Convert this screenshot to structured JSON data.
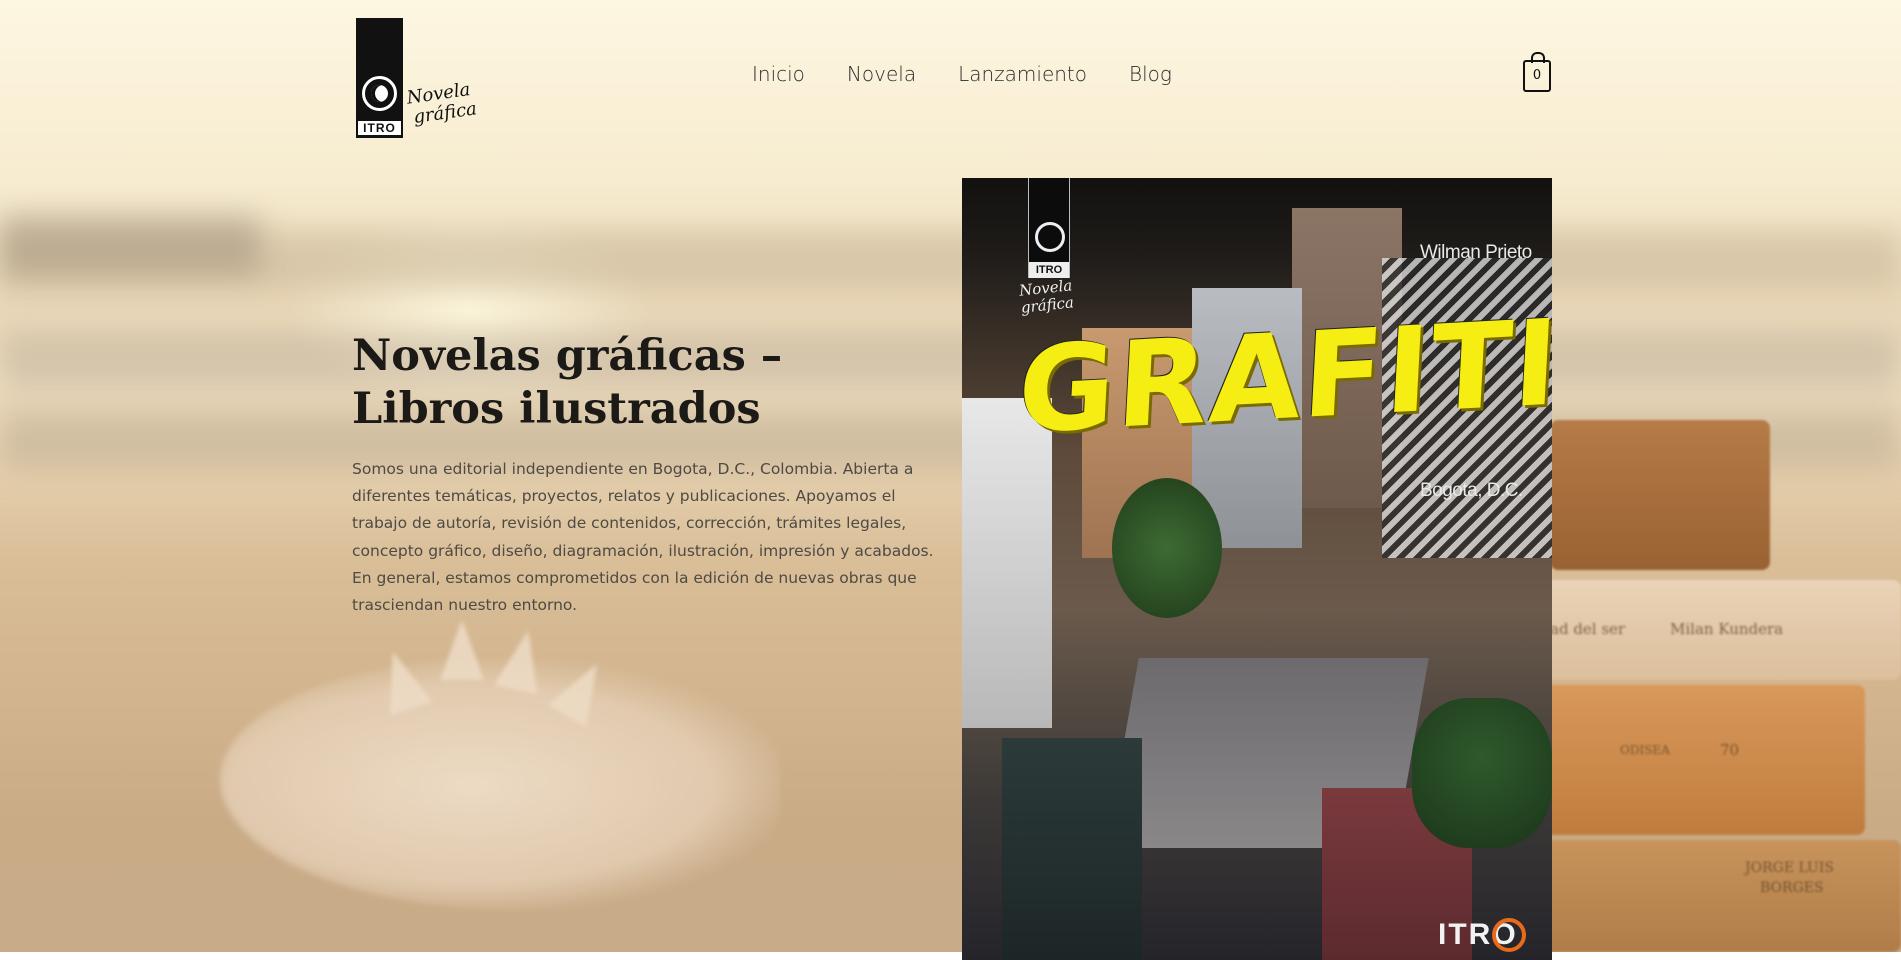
{
  "site": {
    "logo": {
      "badge": "ITRO",
      "script_line1": "Novela",
      "script_line2": "gráfica"
    },
    "nav": [
      {
        "label": "Inicio"
      },
      {
        "label": "Novela"
      },
      {
        "label": "Lanzamiento"
      },
      {
        "label": "Blog"
      }
    ],
    "cart": {
      "count": "0",
      "icon": "shopping-bag-icon"
    }
  },
  "hero": {
    "title": "Novelas gráficas – Libros ilustrados",
    "description": "Somos una editorial independiente en Bogota, D.C., Colombia. Abierta a diferentes temáticas, proyectos, relatos y publicaciones. Apoyamos el trabajo de autoría, revisión de contenidos, corrección, trámites legales, concepto gráfico, diseño, diagramación, ilustración, impresión y acabados. En general, estamos comprometidos con la edición de nuevas obras que trasciendan nuestro entorno."
  },
  "book_cover": {
    "badge": "ITRO",
    "script_line1": "Novela",
    "script_line2": "gráfica",
    "author": "Wilman Prieto",
    "title": "GRAFITI",
    "city": "Bogota, D.C.",
    "publisher": "ITRO"
  },
  "background_books": [
    {
      "label": "ad del ser"
    },
    {
      "label": "Milan Kundera"
    },
    {
      "label": "ODISEA"
    },
    {
      "label": "70"
    },
    {
      "label": "JORGE LUIS"
    },
    {
      "label": "BORGES"
    }
  ]
}
